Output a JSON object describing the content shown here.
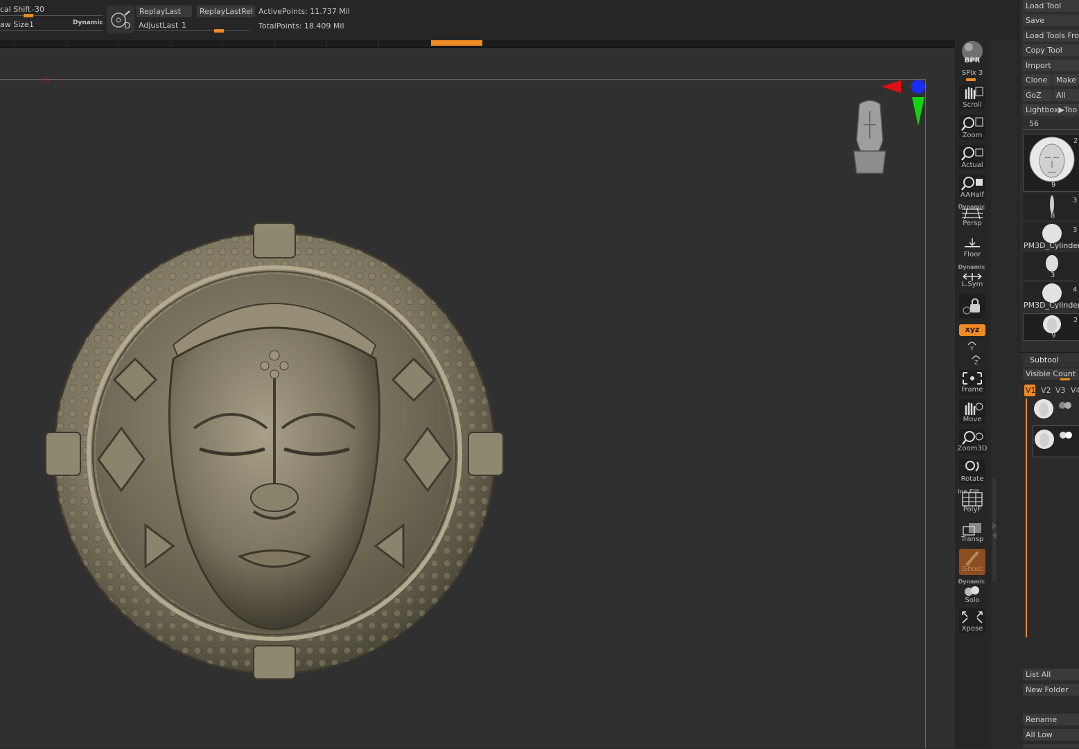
{
  "topbar": {
    "focal_shift_label": "cal Shift",
    "focal_shift_value": "-30",
    "draw_size_label": "aw Size",
    "draw_size_value": "1",
    "dynamic_label": "Dynamic",
    "replay_last": "ReplayLast",
    "replay_last_rel": "ReplayLastRel",
    "adjust_last_label": "AdjustLast",
    "adjust_last_value": "1",
    "active_points": "ActivePoints: 11.737 Mil",
    "total_points": "TotalPoints: 18.409 Mil",
    "lightbox_icon_letter": "D"
  },
  "shelf": {
    "bpr": "BPR",
    "spix_label": "SPix",
    "spix_value": "3",
    "scroll": "Scroll",
    "zoom": "Zoom",
    "actual": "Actual",
    "aahalf": "AAHalf",
    "dynamic_small": "Dynamic",
    "persp": "Persp",
    "floor": "Floor",
    "dynamic_small2": "Dynamic",
    "lsym": "L.Sym",
    "xyz": "xyz",
    "frame": "Frame",
    "move": "Move",
    "zoom3d": "Zoom3D",
    "rotate": "Rotate",
    "line_fill": "ine Fill",
    "polyf": "PolyF",
    "transp": "Transp",
    "ghost": "Ghost",
    "dynamic_small3": "Dynamic",
    "solo": "Solo",
    "xpose": "Xpose"
  },
  "tool_panel": {
    "load_tool": "Load Tool",
    "save": "Save",
    "load_tools_from": "Load Tools Fro",
    "copy_tool": "Copy Tool",
    "import": "Import",
    "clone": "Clone",
    "make": "Make",
    "goz": "GoZ",
    "all": "All",
    "lightbox_tools": "Lightbox▶Too",
    "tool_count": "56",
    "thumbnails": [
      {
        "top": "2",
        "bottom": "9"
      },
      {
        "top": "3",
        "bottom": "8"
      },
      {
        "top": "3",
        "name": "PM3D_Cylinder"
      },
      {
        "top": "",
        "bottom": "3"
      },
      {
        "top": "4",
        "name": "PM3D_Cylinder"
      },
      {
        "top": "2",
        "bottom": "9"
      }
    ]
  },
  "subtool": {
    "title": "Subtool",
    "visible_count": "Visible Count",
    "v1": "V1",
    "v2": "V2",
    "v3": "V3",
    "v4": "V4",
    "list_all": "List All",
    "new_folder": "New Folder",
    "rename": "Rename",
    "all_low": "All Low"
  },
  "colors": {
    "accent": "#f08a22",
    "panel_bg": "#2e2e2e",
    "canvas_bg": "#303030",
    "gizmo_x": "#e11010",
    "gizmo_y": "#13d313",
    "gizmo_z": "#1a2cff",
    "model_bronze": "#8a8266"
  }
}
